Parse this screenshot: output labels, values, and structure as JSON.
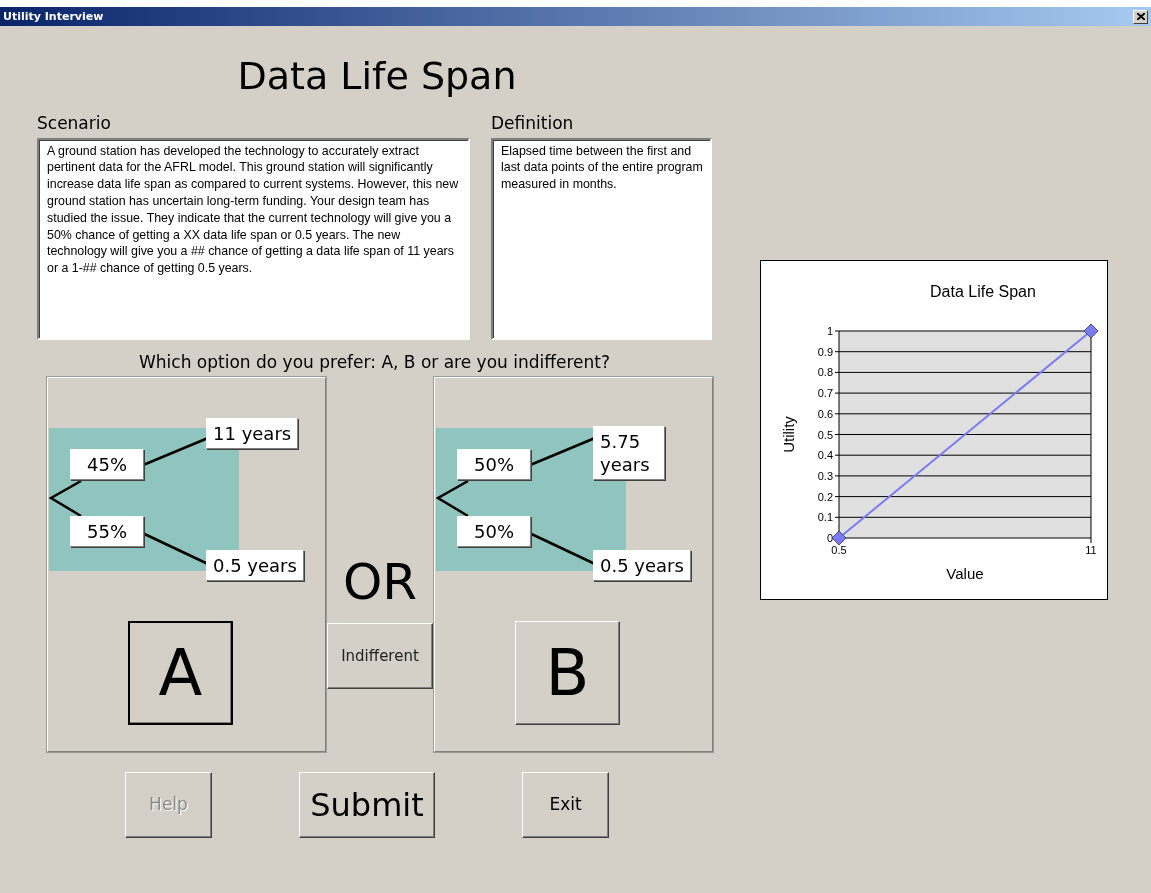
{
  "window": {
    "title": "Utility Interview"
  },
  "heading": "Data Life Span",
  "scenario": {
    "label": "Scenario",
    "text": "A ground station has developed the technology to accurately extract pertinent data for the AFRL model.  This ground station will significantly increase data life span as compared to current systems. However, this new ground station has uncertain long-term funding. Your design team has studied the issue.  They indicate that the current technology will give you a 50% chance of getting a XX data life span or 0.5 years. The new technology will give you a ## chance of getting a data life span of 11 years or a 1-## chance of getting 0.5 years."
  },
  "definition": {
    "label": "Definition",
    "text": "Elapsed time between the first and last data points of the entire program measured in months."
  },
  "question": "Which option do you prefer: A, B or are you indifferent?",
  "options": [
    {
      "label": "A",
      "selected": true,
      "branches": [
        {
          "probability": "45%",
          "outcome": "11 years"
        },
        {
          "probability": "55%",
          "outcome": "0.5 years"
        }
      ]
    },
    {
      "label": "B",
      "selected": false,
      "branches": [
        {
          "probability": "50%",
          "outcome": "5.75 years"
        },
        {
          "probability": "50%",
          "outcome": "0.5 years"
        }
      ]
    }
  ],
  "separator": "OR",
  "indifferent_button": "Indifferent",
  "buttons": [
    {
      "label": "Help",
      "kind": "normal",
      "disabled": true
    },
    {
      "label": "Submit",
      "kind": "large",
      "disabled": false
    },
    {
      "label": "Exit",
      "kind": "normal",
      "disabled": false
    }
  ],
  "chart": {
    "chart_data": {
      "type": "line",
      "title": "Data Life Span",
      "xlabel": "Value",
      "ylabel": "Utility",
      "x": [
        0.5,
        11
      ],
      "series": [
        {
          "color": "#7b7bf0",
          "marker": "diamond",
          "values": [
            0,
            1
          ]
        }
      ],
      "grid": true,
      "xlim": [
        0.5,
        11
      ],
      "ylim": [
        0,
        1
      ],
      "xticks": [
        0.5,
        11
      ],
      "yticks": [
        0,
        0.1,
        0.2,
        0.3,
        0.4,
        0.5,
        0.6,
        0.7,
        0.8,
        0.9,
        1
      ]
    }
  }
}
